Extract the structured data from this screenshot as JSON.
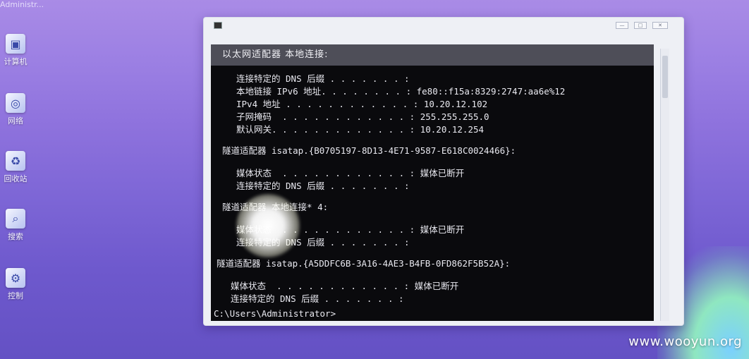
{
  "desktop": {
    "top_fragment": "Administr...",
    "icons": [
      {
        "label": "计算机",
        "icon": "computer-icon"
      },
      {
        "label": "网络",
        "icon": "network-icon"
      },
      {
        "label": "回收站",
        "icon": "recycle-bin-icon"
      },
      {
        "label": "搜索",
        "icon": "search-icon"
      },
      {
        "label": "控制",
        "icon": "control-panel-icon"
      }
    ]
  },
  "console": {
    "adapter_title": "以太网适配器 本地连接:",
    "lines": [
      "连接特定的 DNS 后缀 . . . . . . . :",
      "本地链接 IPv6 地址. . . . . . . . : fe80::f15a:8329:2747:aa6e%12",
      "IPv4 地址 . . . . . . . . . . . . : 10.20.12.102",
      "子网掩码  . . . . . . . . . . . . : 255.255.255.0",
      "默认网关. . . . . . . . . . . . . : 10.20.12.254",
      "隧道适配器 isatap.{B0705197-8D13-4E71-9587-E618C0024466}:",
      "媒体状态  . . . . . . . . . . . . : 媒体已断开",
      "连接特定的 DNS 后缀 . . . . . . . :",
      "隧道适配器 本地连接* 4:",
      "媒体状态  . . . . . . . . . . . . : 媒体已断开",
      "连接特定的 DNS 后缀 . . . . . . . :",
      "隧道适配器 isatap.{A5DDFC6B-3A16-4AE3-B4FB-0FD862F5B52A}:",
      "媒体状态  . . . . . . . . . . . . : 媒体已断开",
      "连接特定的 DNS 后缀 . . . . . . . :",
      "C:\\Users\\Administrator>"
    ]
  },
  "window": {
    "controls": [
      "—",
      "□",
      "✕"
    ]
  },
  "watermark": "www.wooyun.org"
}
